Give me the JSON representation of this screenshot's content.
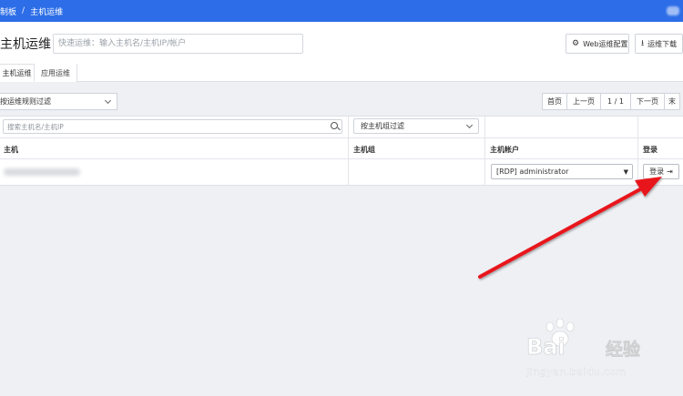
{
  "topbar": {
    "breadcrumbs": [
      "制板",
      "主机运维"
    ],
    "separator": "/"
  },
  "header": {
    "title": "主机运维",
    "quick_search_placeholder": "快速运维：输入主机名/主机IP/帐户",
    "web_config_label": "Web运维配置",
    "web_config_icon": "gear-icon",
    "download_label": "运维下载",
    "download_icon": "download-icon"
  },
  "tabs": [
    {
      "label": "主机运维",
      "active": true
    },
    {
      "label": "应用运维",
      "active": false
    }
  ],
  "filter": {
    "rule_filter_label": "按运维规则过滤"
  },
  "pager": {
    "first": "首页",
    "prev": "上一页",
    "page_info": "1 / 1",
    "next": "下一页",
    "last": "末"
  },
  "table": {
    "search_placeholder": "搜索主机名/主机IP",
    "group_filter_label": "按主机组过滤",
    "columns": [
      "主机",
      "主机组",
      "主机帐户",
      "登录"
    ],
    "rows": [
      {
        "host": "",
        "host_group": "",
        "account": "[RDP] administrator",
        "login_label": "登录"
      }
    ]
  },
  "colors": {
    "topbar": "#2d6ee8",
    "background": "#eef0f4",
    "arrow": "#e8141a"
  },
  "watermark": {
    "brand": "Bai",
    "brand_cn": "经验",
    "url": "jingyan.baidu.com"
  }
}
